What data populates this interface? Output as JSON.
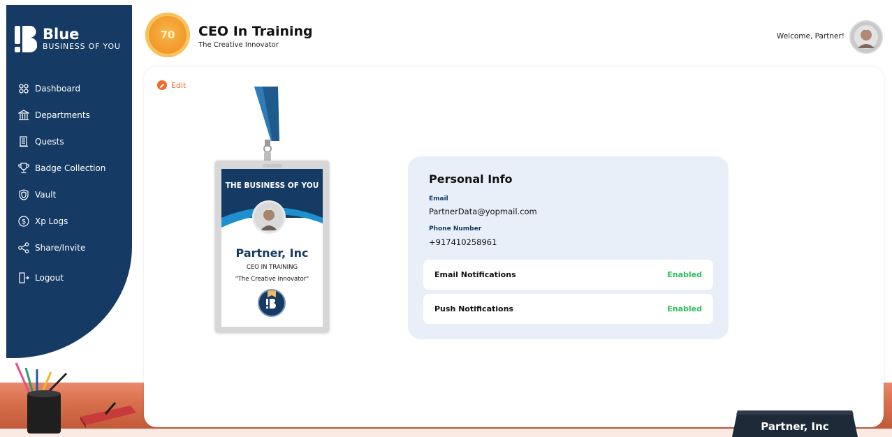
{
  "brand": {
    "title": "Blue",
    "subtitle": "BUSINESS OF YOU"
  },
  "sidebar": {
    "items": [
      {
        "label": "Dashboard",
        "icon": "dashboard-grid-icon"
      },
      {
        "label": "Departments",
        "icon": "bank-icon"
      },
      {
        "label": "Quests",
        "icon": "scroll-icon"
      },
      {
        "label": "Badge Collection",
        "icon": "trophy-icon"
      },
      {
        "label": "Vault",
        "icon": "shield-icon"
      },
      {
        "label": "Xp Logs",
        "icon": "dollar-coin-icon"
      },
      {
        "label": "Share/Invite",
        "icon": "share-icon"
      },
      {
        "label": "Logout",
        "icon": "logout-door-icon"
      }
    ]
  },
  "header": {
    "level": "70",
    "rank_title": "CEO In Training",
    "rank_subtitle": "The Creative Innovator",
    "welcome": "Welcome, Partner!"
  },
  "edit_label": "Edit",
  "id_card": {
    "title": "THE BUSINESS OF YOU",
    "name": "Partner, Inc",
    "role": "CEO IN TRAINING",
    "tagline": "\"The Creative Innovator\""
  },
  "personal_info": {
    "title": "Personal Info",
    "email_label": "Email",
    "email": "PartnerData@yopmail.com",
    "phone_label": "Phone Number",
    "phone": "+917410258961",
    "notifications": [
      {
        "label": "Email Notifications",
        "status": "Enabled"
      },
      {
        "label": "Push Notifications",
        "status": "Enabled"
      }
    ]
  },
  "nameplate": "Partner, Inc",
  "colors": {
    "navy": "#153a63",
    "accent": "#f26a2a",
    "enabled": "#2cbd5a",
    "panel": "#e9eff9"
  }
}
